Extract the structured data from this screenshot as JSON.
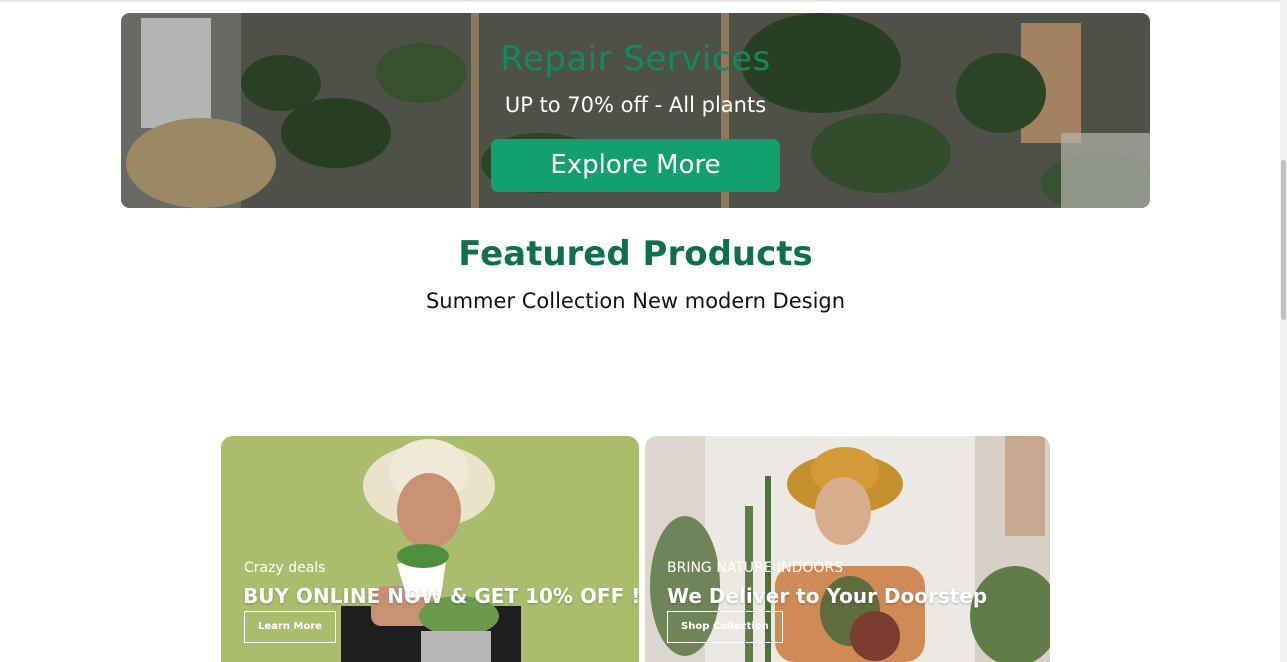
{
  "banner": {
    "title": "Repair Services",
    "subtitle": "UP to 70% off - All plants",
    "button_label": "Explore More"
  },
  "featured": {
    "title": "Featured Products",
    "subtitle": "Summer Collection New modern Design"
  },
  "promos": [
    {
      "kicker": "Crazy deals",
      "headline": "BUY ONLINE NOW & GET 10% OFF !",
      "button_label": "Learn More"
    },
    {
      "kicker": "BRING NATURE INDOORS",
      "headline": "We Deliver to Your Doorstep",
      "button_label": "Shop Collection"
    }
  ],
  "colors": {
    "accent_green": "#12a06e",
    "title_green": "#106f4c"
  }
}
